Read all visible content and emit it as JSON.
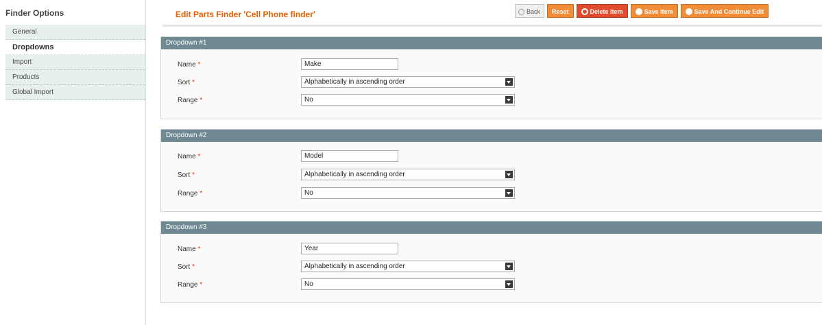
{
  "sidebar": {
    "title": "Finder Options",
    "tabs": [
      {
        "label": "General"
      },
      {
        "label": "Dropdowns"
      },
      {
        "label": "Import"
      },
      {
        "label": "Products"
      },
      {
        "label": "Global Import"
      }
    ],
    "active_tab": "Dropdowns"
  },
  "header": {
    "title": "Edit Parts Finder 'Cell Phone finder'",
    "buttons": {
      "back": "Back",
      "reset": "Reset",
      "delete": "Delete Item",
      "save": "Save Item",
      "save_continue": "Save And Continue Edit"
    }
  },
  "dropdowns": [
    {
      "heading": "Dropdown #1",
      "name_label": "Name",
      "name_value": "Make",
      "sort_label": "Sort",
      "sort_value": "Alphabetically in ascending order",
      "range_label": "Range",
      "range_value": "No"
    },
    {
      "heading": "Dropdown #2",
      "name_label": "Name",
      "name_value": "Model",
      "sort_label": "Sort",
      "sort_value": "Alphabetically in ascending order",
      "range_label": "Range",
      "range_value": "No"
    },
    {
      "heading": "Dropdown #3",
      "name_label": "Name",
      "name_value": "Year",
      "sort_label": "Sort",
      "sort_value": "Alphabetically in ascending order",
      "range_label": "Range",
      "range_value": "No"
    }
  ],
  "required_marker": "*",
  "colors": {
    "accent": "#eb5e00",
    "section_header": "#6f8992",
    "button_orange": "#f18c38",
    "button_red": "#e04c2d"
  }
}
